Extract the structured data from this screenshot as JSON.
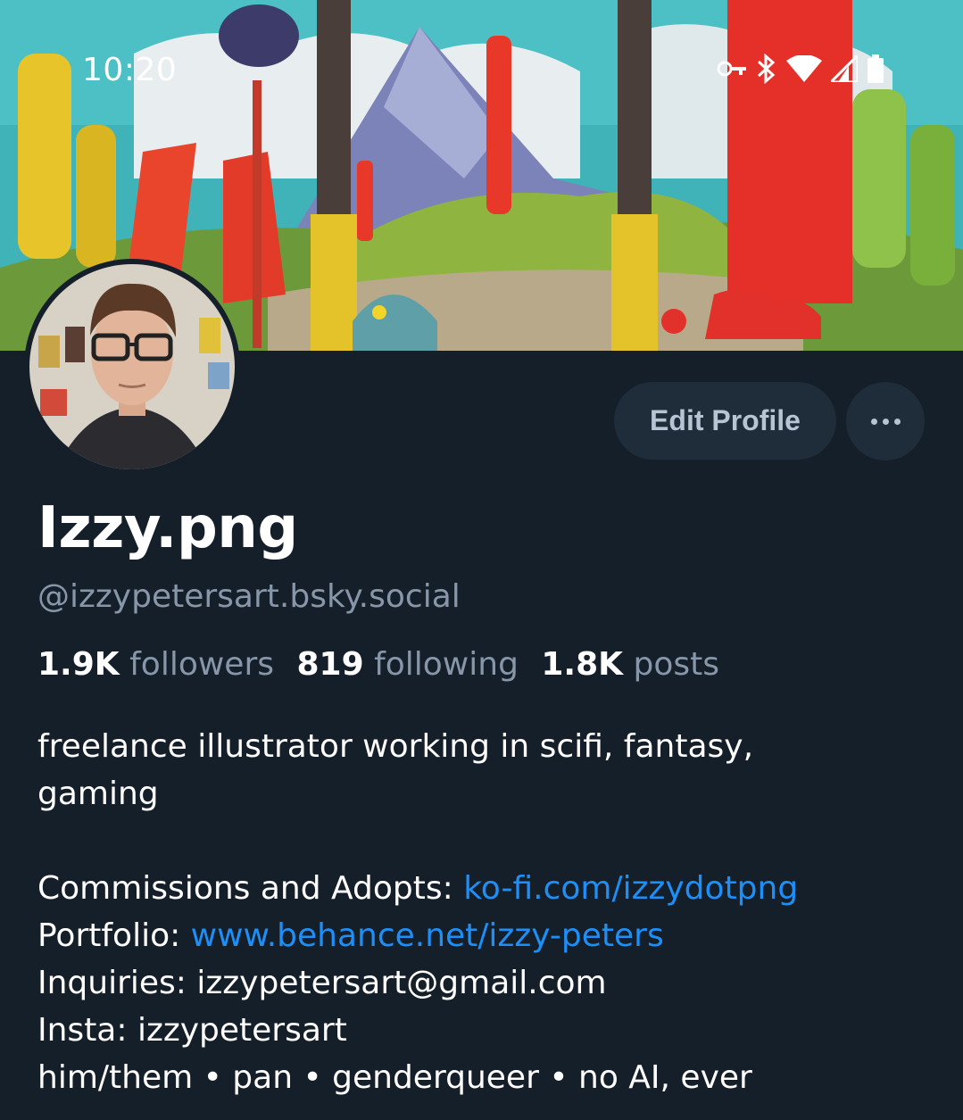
{
  "status_bar": {
    "time": "10:20",
    "icons": [
      "vpn-key-icon",
      "bluetooth-icon",
      "wifi-icon",
      "cell-signal-icon",
      "battery-icon"
    ]
  },
  "profile": {
    "display_name": "Izzy.png",
    "handle": "@izzypetersart.bsky.social",
    "edit_button": "Edit Profile",
    "more_icon": "more-options-icon",
    "stats": {
      "followers_count": "1.9K",
      "followers_label": "followers",
      "following_count": "819",
      "following_label": "following",
      "posts_count": "1.8K",
      "posts_label": "posts"
    },
    "bio": {
      "line1": "freelance illustrator working in scifi, fantasy,",
      "line2": "gaming",
      "commissions_label": "Commissions and Adopts: ",
      "commissions_link": "ko-fi.com/izzydotpng",
      "portfolio_label": "Portfolio: ",
      "portfolio_link": "www.behance.net/izzy-peters",
      "inquiries": "Inquiries: izzypetersart@gmail.com",
      "insta": "Insta: izzypetersart",
      "pronouns": "him/them • pan • genderqueer • no AI, ever"
    }
  },
  "colors": {
    "background": "#151f29",
    "button_bg": "#1f2c3a",
    "secondary_text": "#8796a8",
    "link": "#1d8ff8"
  }
}
